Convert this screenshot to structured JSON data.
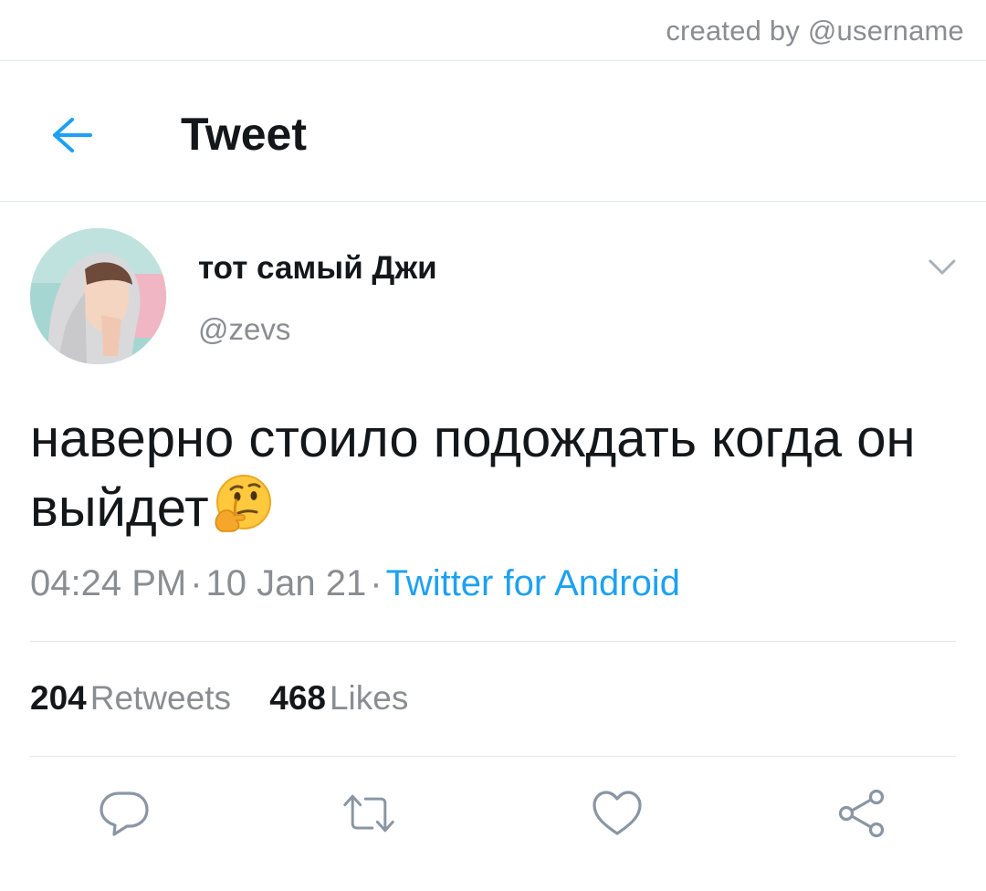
{
  "credit": "created by @username",
  "header": {
    "title": "Tweet",
    "back_icon": "arrow-left-icon"
  },
  "author": {
    "display_name": "тот самый Джи",
    "handle": "@zevs"
  },
  "tweet": {
    "text": "наверно стоило подождать когда он выйдет",
    "emoji_icon": "thinking-face-icon",
    "time": "04:24 PM",
    "separator": "·",
    "date": "10 Jan 21",
    "source": "Twitter for Android"
  },
  "stats": {
    "retweets_count": "204",
    "retweets_label": "Retweets",
    "likes_count": "468",
    "likes_label": "Likes"
  },
  "actions": [
    "reply-icon",
    "retweet-icon",
    "like-icon",
    "share-icon"
  ],
  "colors": {
    "accent": "#1da1f2",
    "text_primary": "#14171a",
    "text_secondary": "#8a8d91",
    "divider": "#e3e6e8"
  }
}
